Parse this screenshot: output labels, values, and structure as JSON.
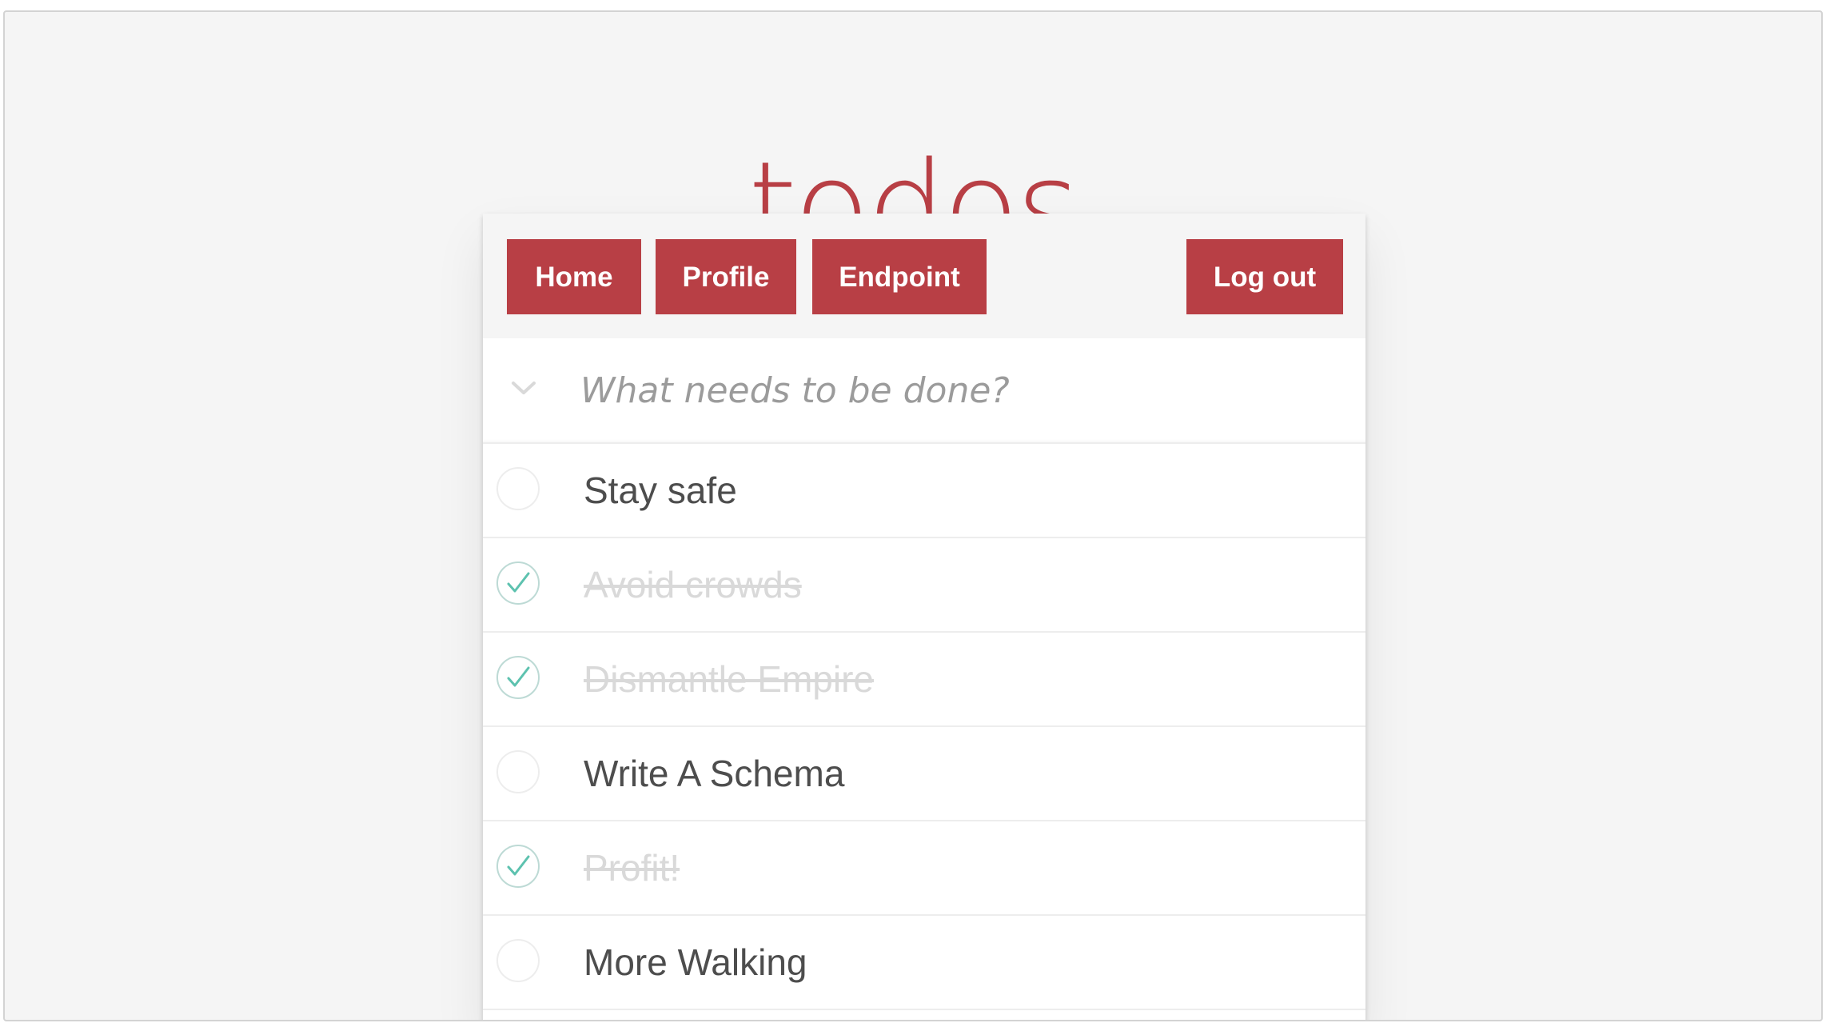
{
  "header": {
    "title": "todos"
  },
  "nav": {
    "home_label": "Home",
    "profile_label": "Profile",
    "endpoint_label": "Endpoint",
    "logout_label": "Log out"
  },
  "new_todo": {
    "placeholder": "What needs to be done?",
    "value": ""
  },
  "todos": [
    {
      "title": "Stay safe",
      "completed": false
    },
    {
      "title": "Avoid crowds",
      "completed": true
    },
    {
      "title": "Dismantle Empire",
      "completed": true
    },
    {
      "title": "Write A Schema",
      "completed": false
    },
    {
      "title": "Profit!",
      "completed": true
    },
    {
      "title": "More Walking",
      "completed": false
    }
  ],
  "colors": {
    "accent": "#b83f45",
    "check_green": "#5dc2af",
    "circle_gray": "#ededed",
    "background": "#f5f5f5"
  },
  "icons": {
    "toggle_all": "chevron-down-icon",
    "unchecked": "circle-icon",
    "checked": "check-circle-icon"
  }
}
